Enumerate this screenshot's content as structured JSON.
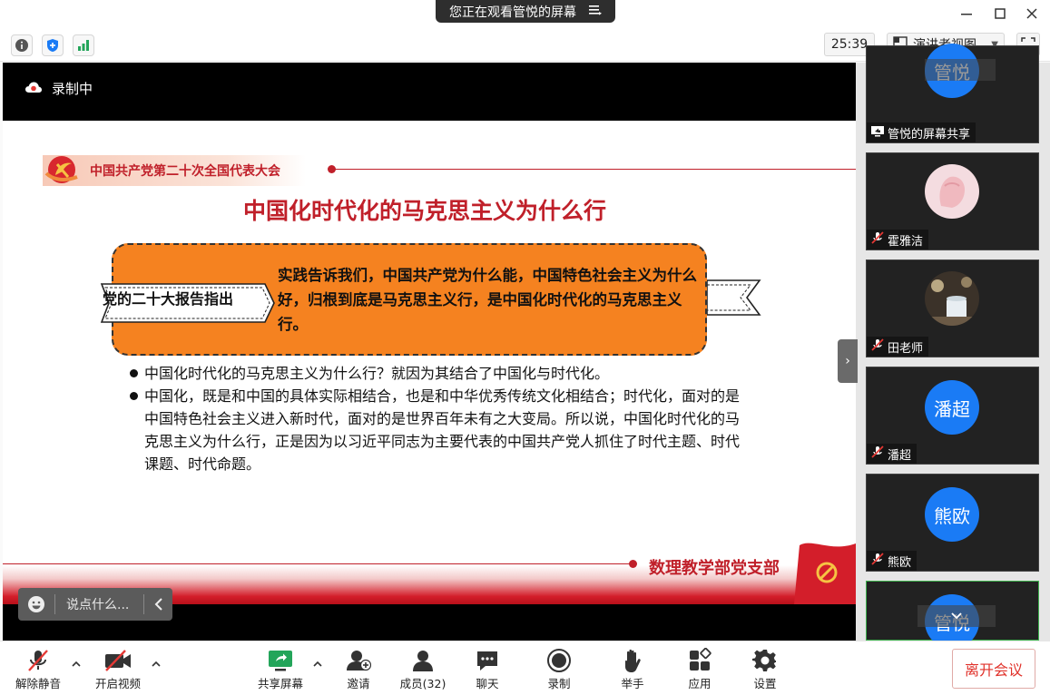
{
  "window": {
    "viewing_label": "您正在观看管悦的屏幕",
    "minimize_glyph": "—",
    "maximize_glyph": "☐",
    "close_glyph": "✕"
  },
  "infobar": {
    "timer": "25:39",
    "view_mode": "演讲者视图"
  },
  "stage": {
    "recording_label": "录制中",
    "chat_placeholder": "说点什么..."
  },
  "slide": {
    "congress": "中国共产党第二十次全国代表大会",
    "title": "中国化时代化的马克思主义为什么行",
    "banner_label": "党的二十大报告指出",
    "quote": "实践告诉我们，中国共产党为什么能，中国特色社会主义为什么好，归根到底是马克思主义行，是中国化时代化的马克思主义行。",
    "bullets": [
      "中国化时代化的马克思主义为什么行？就因为其结合了中国化与时代化。",
      "中国化，既是和中国的具体实际相结合，也是和中华优秀传统文化相结合；时代化，面对的是中国特色社会主义进入新时代，面对的是世界百年未有之大变局。所以说，中国化时代化的马克思主义为什么行，正是因为以习近平同志为主要代表的中国共产党人抓住了时代主题、时代课题、时代命题。"
    ],
    "department": "数理教学部党支部"
  },
  "gallery": {
    "tiles": [
      {
        "avatar_text": "管悦",
        "name": "管悦的屏幕共享",
        "kind": "screen-share"
      },
      {
        "avatar_text": "",
        "name": "霍雅洁",
        "kind": "photo-hand"
      },
      {
        "avatar_text": "",
        "name": "田老师",
        "kind": "photo-cup"
      },
      {
        "avatar_text": "潘超",
        "name": "潘超",
        "kind": "initials"
      },
      {
        "avatar_text": "熊欧",
        "name": "熊欧",
        "kind": "initials"
      },
      {
        "avatar_text": "管悦",
        "name": "",
        "kind": "initials"
      }
    ]
  },
  "toolbar": {
    "unmute": "解除静音",
    "start_video": "开启视频",
    "share_screen": "共享屏幕",
    "invite": "邀请",
    "members": "成员(32)",
    "chat": "聊天",
    "record": "录制",
    "raise_hand": "举手",
    "apps": "应用",
    "settings": "设置",
    "leave": "离开会议"
  },
  "colors": {
    "accent_red": "#c0202a",
    "slide_orange": "#f58220",
    "avatar_blue": "#1a7bf5",
    "share_green": "#23a55a",
    "leave_red": "#e0312a"
  }
}
